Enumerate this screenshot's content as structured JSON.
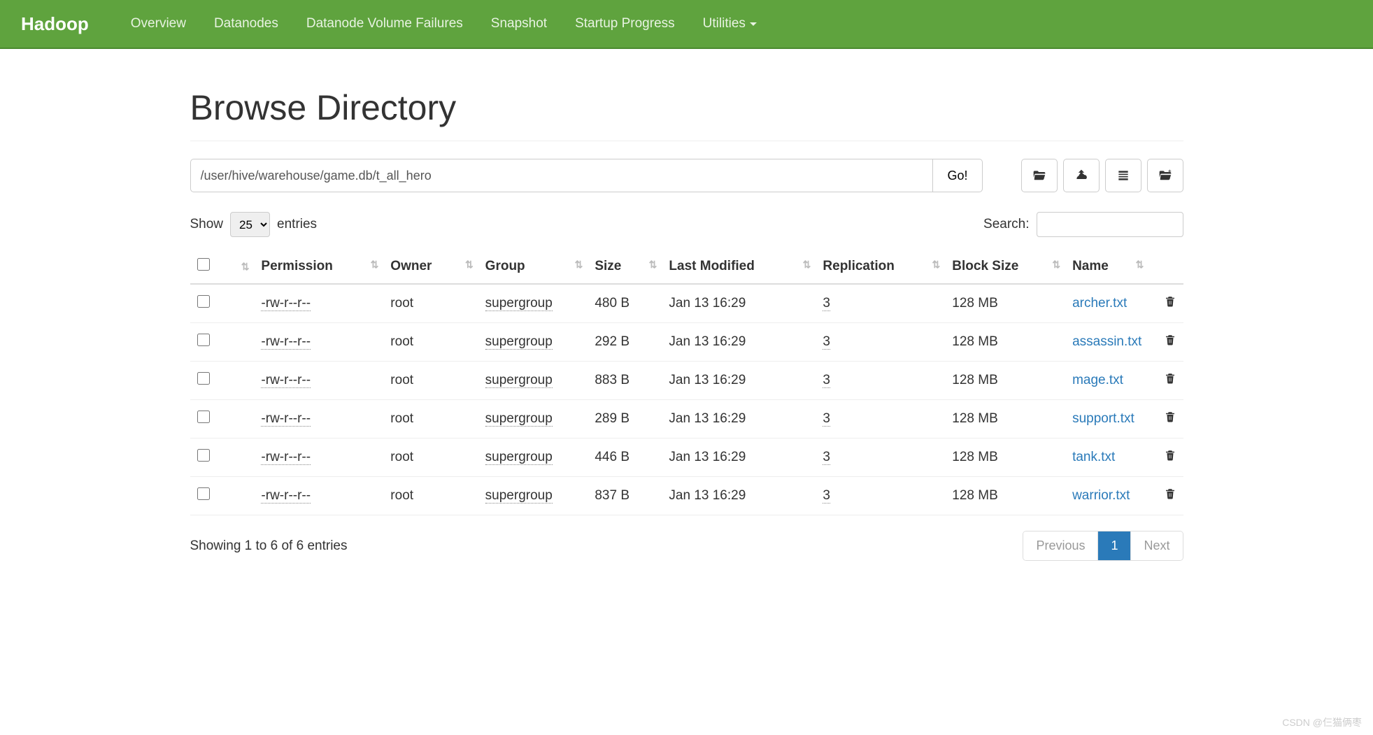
{
  "nav": {
    "brand": "Hadoop",
    "items": [
      "Overview",
      "Datanodes",
      "Datanode Volume Failures",
      "Snapshot",
      "Startup Progress",
      "Utilities"
    ]
  },
  "page": {
    "title": "Browse Directory",
    "path_value": "/user/hive/warehouse/game.db/t_all_hero",
    "go_label": "Go!"
  },
  "entries_control": {
    "show_label": "Show",
    "entries_label": "entries",
    "selected": "25"
  },
  "search": {
    "label": "Search:",
    "value": ""
  },
  "table": {
    "headers": {
      "permission": "Permission",
      "owner": "Owner",
      "group": "Group",
      "size": "Size",
      "last_modified": "Last Modified",
      "replication": "Replication",
      "block_size": "Block Size",
      "name": "Name"
    },
    "rows": [
      {
        "permission": "-rw-r--r--",
        "owner": "root",
        "group": "supergroup",
        "size": "480 B",
        "last_modified": "Jan 13 16:29",
        "replication": "3",
        "block_size": "128 MB",
        "name": "archer.txt"
      },
      {
        "permission": "-rw-r--r--",
        "owner": "root",
        "group": "supergroup",
        "size": "292 B",
        "last_modified": "Jan 13 16:29",
        "replication": "3",
        "block_size": "128 MB",
        "name": "assassin.txt"
      },
      {
        "permission": "-rw-r--r--",
        "owner": "root",
        "group": "supergroup",
        "size": "883 B",
        "last_modified": "Jan 13 16:29",
        "replication": "3",
        "block_size": "128 MB",
        "name": "mage.txt"
      },
      {
        "permission": "-rw-r--r--",
        "owner": "root",
        "group": "supergroup",
        "size": "289 B",
        "last_modified": "Jan 13 16:29",
        "replication": "3",
        "block_size": "128 MB",
        "name": "support.txt"
      },
      {
        "permission": "-rw-r--r--",
        "owner": "root",
        "group": "supergroup",
        "size": "446 B",
        "last_modified": "Jan 13 16:29",
        "replication": "3",
        "block_size": "128 MB",
        "name": "tank.txt"
      },
      {
        "permission": "-rw-r--r--",
        "owner": "root",
        "group": "supergroup",
        "size": "837 B",
        "last_modified": "Jan 13 16:29",
        "replication": "3",
        "block_size": "128 MB",
        "name": "warrior.txt"
      }
    ]
  },
  "footer": {
    "info": "Showing 1 to 6 of 6 entries",
    "prev": "Previous",
    "page": "1",
    "next": "Next"
  },
  "watermark": "CSDN @仨猫俩枣"
}
